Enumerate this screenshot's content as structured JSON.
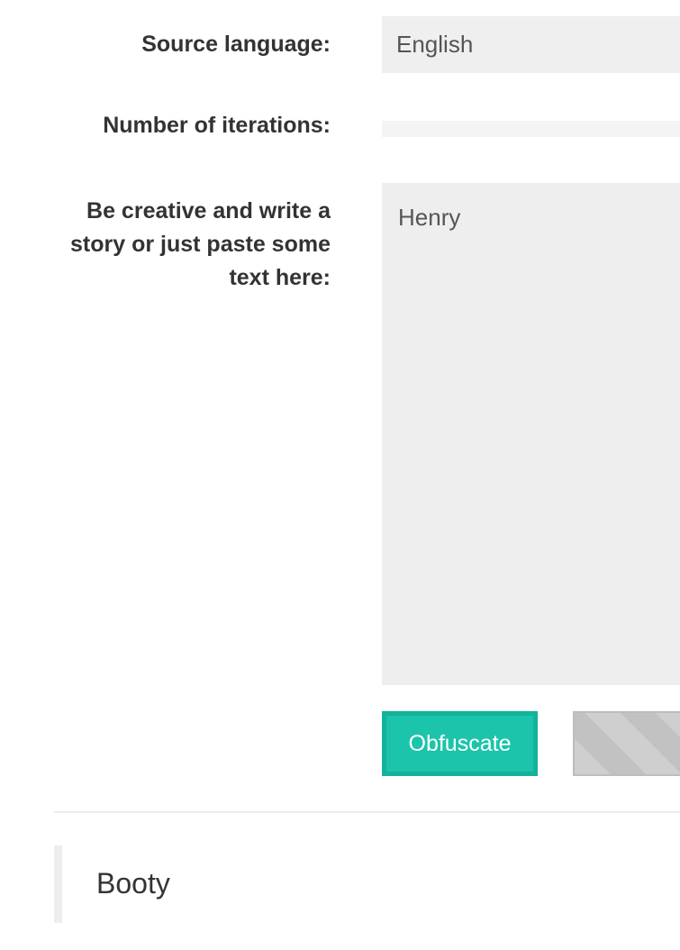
{
  "form": {
    "source_language": {
      "label": "Source language:",
      "value": "English"
    },
    "iterations": {
      "label": "Number of iterations:",
      "value": ""
    },
    "story": {
      "label": "Be creative and write a story or just paste some text here:",
      "value": "Henry"
    },
    "obfuscate_button": "Obfuscate"
  },
  "result": {
    "text": "Booty"
  },
  "colors": {
    "accent": "#1bc4aa",
    "field_background": "#eeeeee"
  }
}
